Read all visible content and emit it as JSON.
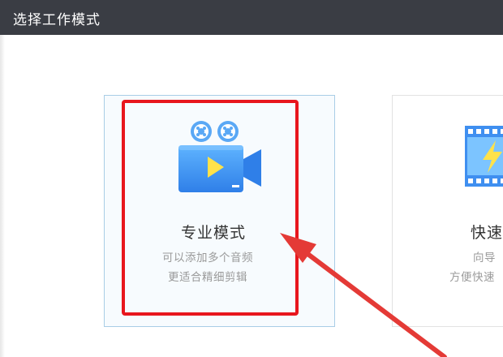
{
  "window": {
    "title": "选择工作模式"
  },
  "modes": [
    {
      "title": "专业模式",
      "desc_line1": "可以添加多个音频",
      "desc_line2": "更适合精细剪辑",
      "icon": "video-camera-icon",
      "selected": true
    },
    {
      "title": "快速",
      "desc_line1": "向导",
      "desc_line2": "方便快速",
      "icon": "film-lightning-icon",
      "selected": false
    }
  ],
  "colors": {
    "titlebar": "#3a3d44",
    "accent_blue": "#3d8ef0",
    "highlight_red": "#e8161d",
    "arrow_red": "#e43a36"
  }
}
